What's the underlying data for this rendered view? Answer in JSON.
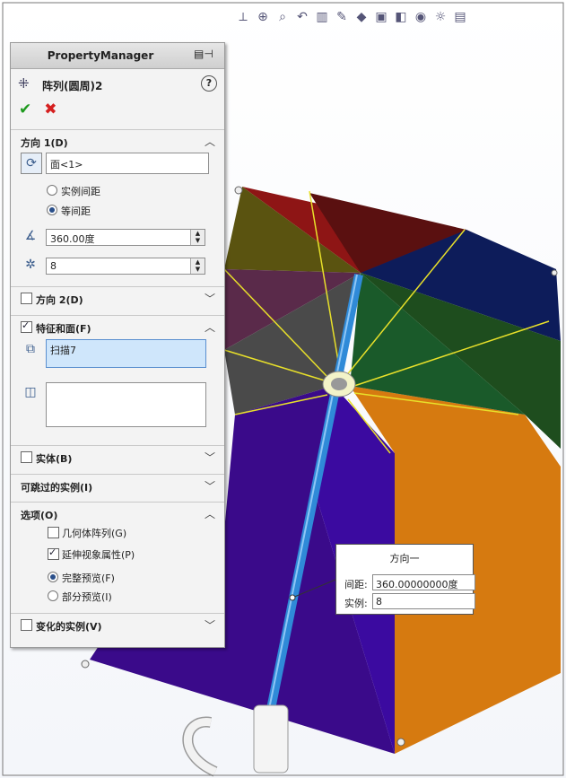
{
  "toolbar": {
    "icons": [
      "view-orient-icon",
      "zoom-fit-icon",
      "zoom-area-icon",
      "previous-view-icon",
      "section-view-icon",
      "dynamic-annotation-icon",
      "view-cube-icon",
      "display-style-icon",
      "hide-show-icon",
      "appearance-icon",
      "scene-icon",
      "settings-icon"
    ]
  },
  "pm": {
    "header": "PropertyManager",
    "feature_name": "阵列(圆周)2",
    "help": "?",
    "ok_symbol": "✔",
    "cancel_symbol": "✖",
    "direction1": {
      "label": "方向 1(D)",
      "face": "面<1>",
      "opt_instance_spacing": "实例间距",
      "opt_equal_spacing": "等间距",
      "angle": "360.00度",
      "count": "8"
    },
    "direction2": {
      "label": "方向 2(D)"
    },
    "features_faces": {
      "label": "特征和面(F)",
      "feature_item": "扫描7"
    },
    "bodies": {
      "label": "实体(B)"
    },
    "skip_instances": {
      "label": "可跳过的实例(I)"
    },
    "options": {
      "label": "选项(O)",
      "geometry_pattern": "几何体阵列(G)",
      "propagate_visual": "延伸视象属性(P)",
      "full_preview": "完整预览(F)",
      "partial_preview": "部分预览(I)"
    },
    "varying_instances": {
      "label": "变化的实例(V)"
    }
  },
  "callout": {
    "title": "方向一",
    "spacing_label": "间距:",
    "spacing_value": "360.00000000度",
    "instances_label": "实例:",
    "instances_value": "8"
  },
  "colors": {
    "shaft": "#2f8ad8",
    "sketch": "#e8e02a",
    "panel_bg": "#f3f3f3"
  }
}
